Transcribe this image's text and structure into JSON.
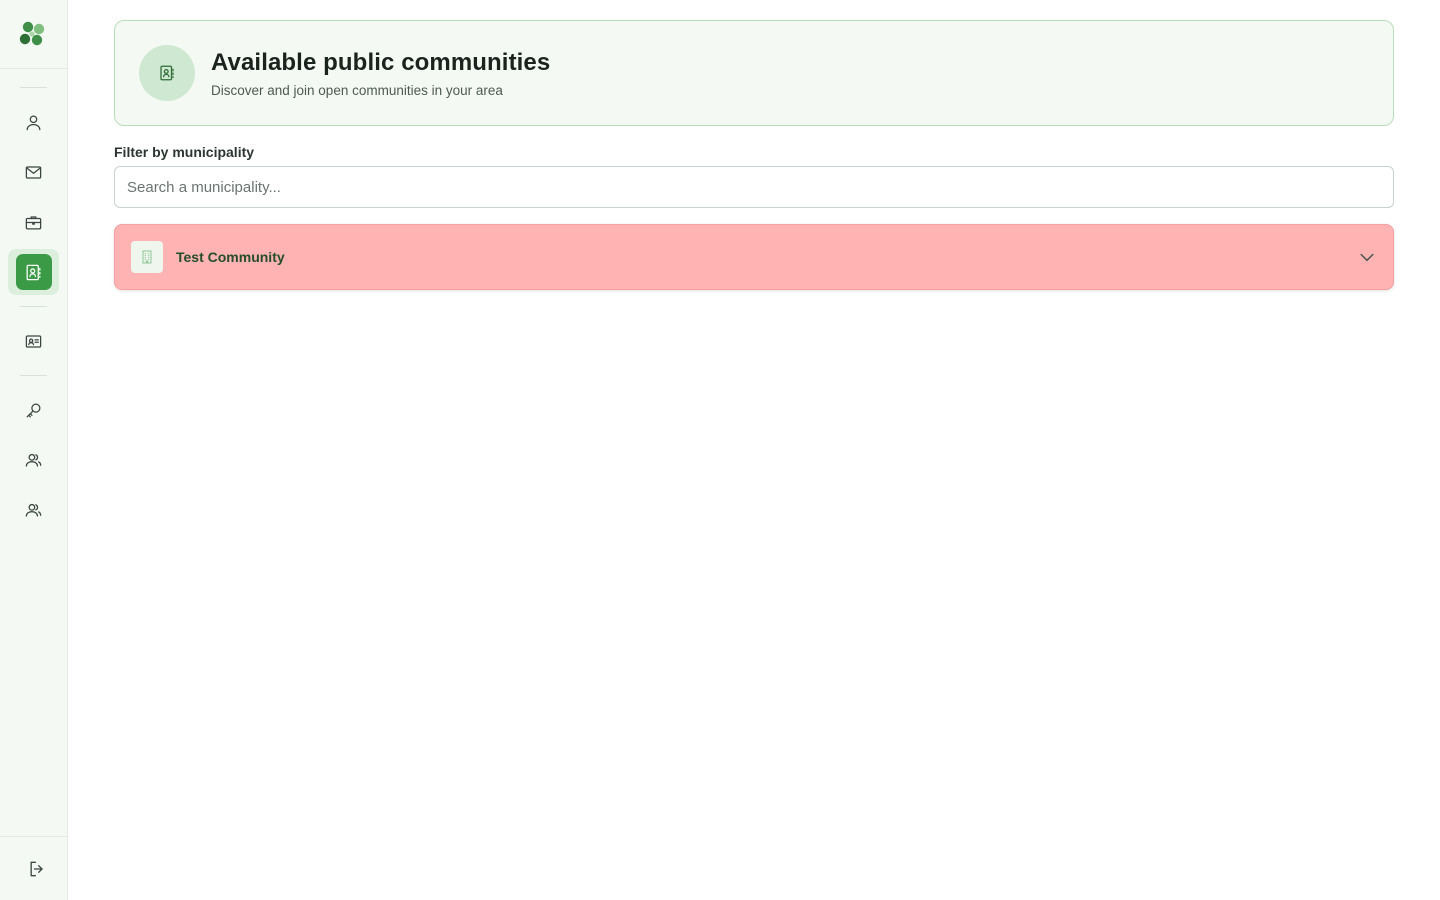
{
  "sidebar": {
    "logo_icon": "clover-logo-icon",
    "items": [
      {
        "icon": "user-icon",
        "active": false
      },
      {
        "icon": "mail-icon",
        "active": false
      },
      {
        "icon": "briefcase-icon",
        "active": false
      },
      {
        "icon": "contact-book-icon",
        "active": true
      },
      {
        "icon": "id-card-icon",
        "active": false
      },
      {
        "icon": "key-icon",
        "active": false
      },
      {
        "icon": "users-icon",
        "active": false
      },
      {
        "icon": "users-icon",
        "active": false
      }
    ],
    "logout_icon": "logout-icon",
    "accent_color": "#3a9a45"
  },
  "header": {
    "title": "Available public communities",
    "subtitle": "Discover and join open communities in your area",
    "icon": "contact-book-icon"
  },
  "filter": {
    "label": "Filter by municipality",
    "placeholder": "Search a municipality...",
    "value": ""
  },
  "communities": [
    {
      "name": "Test Community",
      "icon": "building-icon",
      "expand_icon": "chevron-down-icon",
      "background": "#ffb3b3"
    }
  ]
}
